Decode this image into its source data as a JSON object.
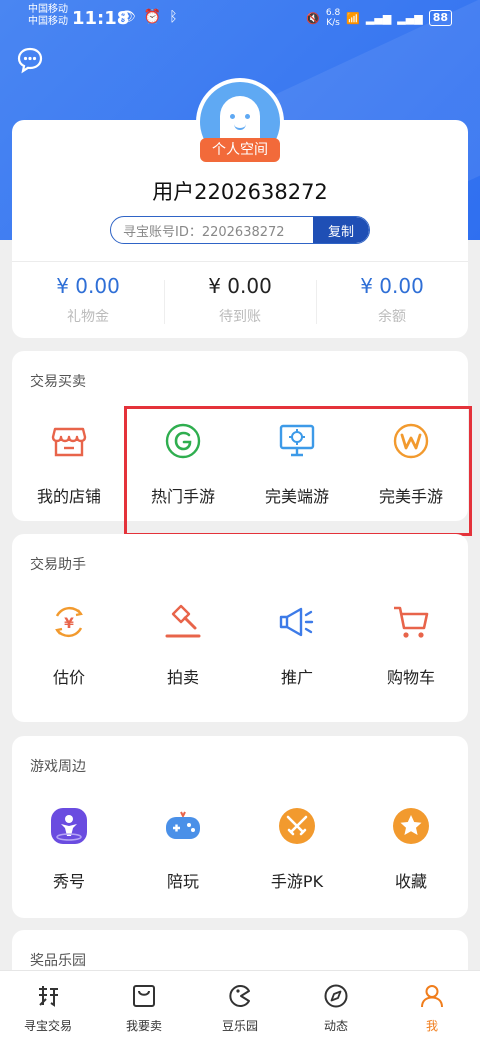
{
  "status_bar": {
    "carrier1": "中国移动",
    "carrier2": "中国移动",
    "time": "11:18",
    "net_speed_value": "6.8",
    "net_speed_unit": "K/s",
    "battery": "88"
  },
  "profile": {
    "badge": "个人空间",
    "username": "用户2202638272",
    "account_label": "寻宝账号ID：2202638272",
    "copy_label": "复制",
    "stats": [
      {
        "value": "¥ 0.00",
        "label": "礼物金",
        "color": "#2f6fd6"
      },
      {
        "value": "¥ 0.00",
        "label": "待到账",
        "color": "#222222"
      },
      {
        "value": "¥ 0.00",
        "label": "余额",
        "color": "#2f6fd6"
      }
    ]
  },
  "sections": {
    "trade": {
      "title": "交易买卖",
      "items": [
        {
          "label": "我的店铺",
          "icon": "store-icon"
        },
        {
          "label": "热门手游",
          "icon": "hot-mobile-game-icon"
        },
        {
          "label": "完美端游",
          "icon": "pc-game-icon"
        },
        {
          "label": "完美手游",
          "icon": "perfect-mobile-game-icon"
        }
      ]
    },
    "assistant": {
      "title": "交易助手",
      "items": [
        {
          "label": "估价",
          "icon": "valuation-icon"
        },
        {
          "label": "拍卖",
          "icon": "auction-icon"
        },
        {
          "label": "推广",
          "icon": "megaphone-icon"
        },
        {
          "label": "购物车",
          "icon": "cart-icon"
        }
      ]
    },
    "games": {
      "title": "游戏周边",
      "items": [
        {
          "label": "秀号",
          "icon": "show-account-icon"
        },
        {
          "label": "陪玩",
          "icon": "gamepad-icon"
        },
        {
          "label": "手游PK",
          "icon": "swords-icon"
        },
        {
          "label": "收藏",
          "icon": "star-icon"
        }
      ]
    },
    "prizes": {
      "title": "奖品乐园"
    }
  },
  "bottom_nav": [
    {
      "label": "寻宝交易",
      "icon": "treasure-trade-icon"
    },
    {
      "label": "我要卖",
      "icon": "sell-bag-icon"
    },
    {
      "label": "豆乐园",
      "icon": "bean-park-icon"
    },
    {
      "label": "动态",
      "icon": "compass-icon"
    },
    {
      "label": "我",
      "icon": "user-icon",
      "active": true
    }
  ],
  "colors": {
    "brand_blue": "#2f6ff0",
    "accent_orange": "#f07d1c",
    "highlight_red": "#e4323a"
  }
}
